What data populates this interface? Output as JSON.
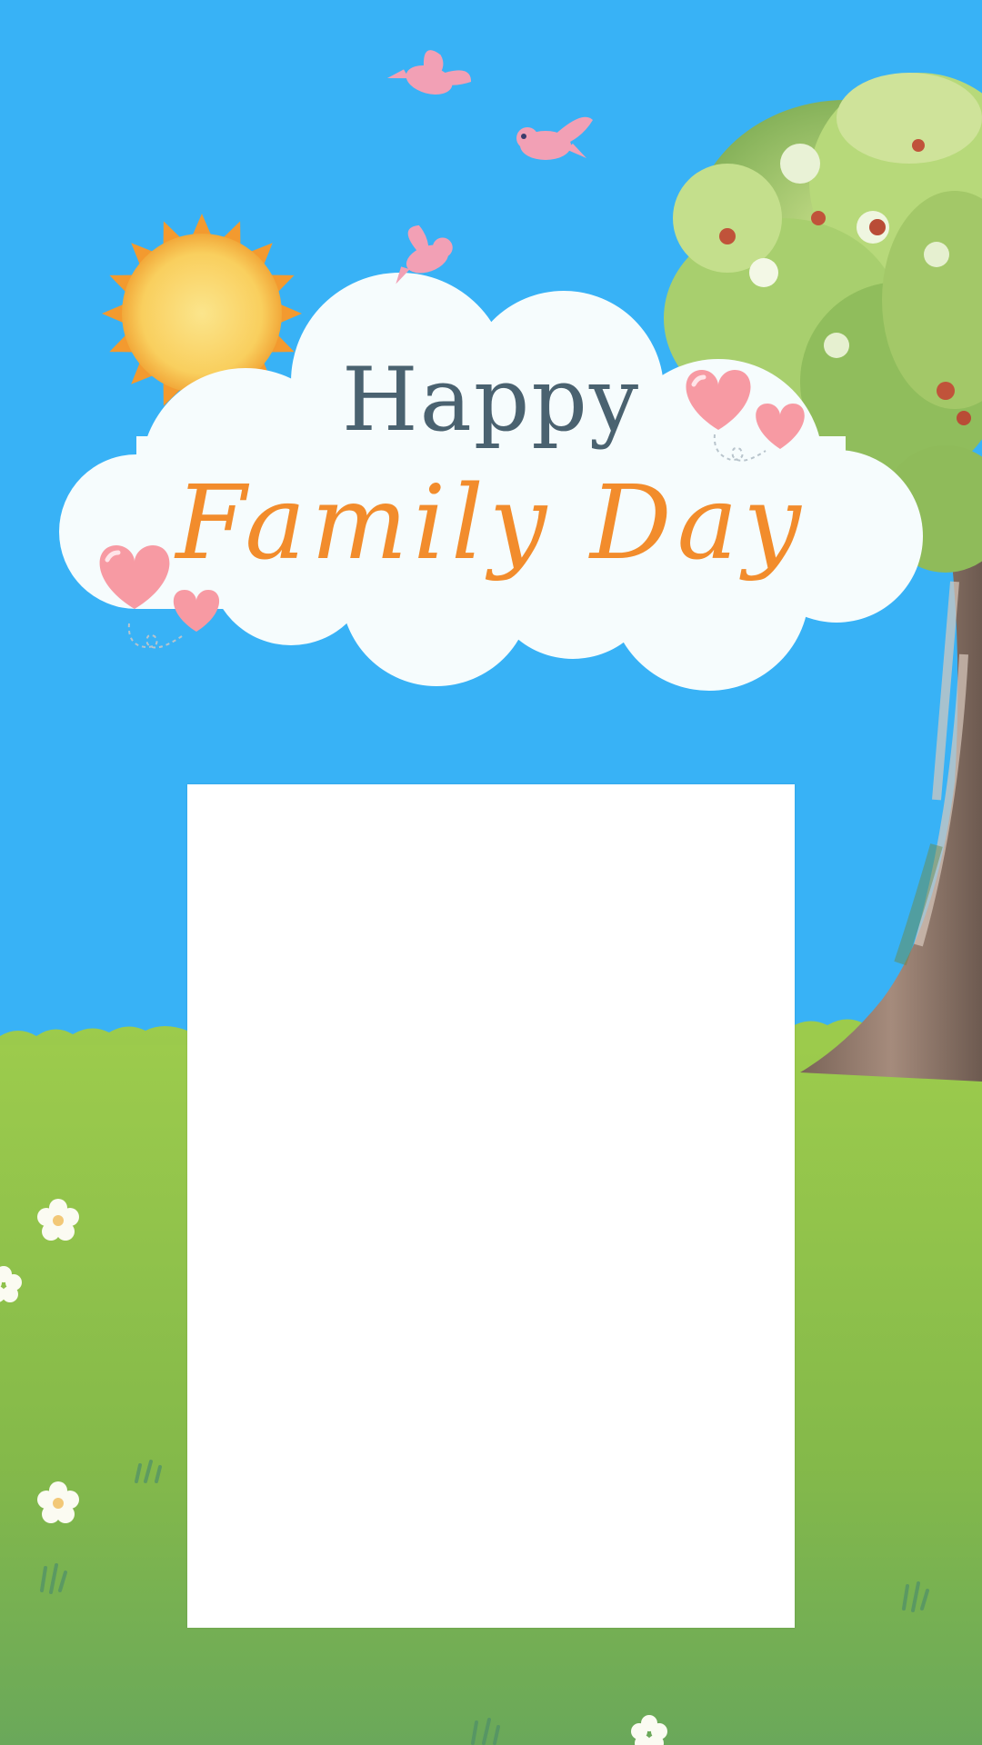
{
  "greeting": {
    "line1": "Happy",
    "line2": "Family Day"
  },
  "colors": {
    "sky": "#38b2f6",
    "grass": "#8cc048",
    "cloud": "#f6fcfd",
    "title": "#4a6270",
    "script": "#f28c2c",
    "heart": "#f79aa3",
    "photo_frame": "#ffffff"
  },
  "decorations": [
    "sun-icon",
    "bird-icon",
    "cloud",
    "heart-icon",
    "tree",
    "flower-icon"
  ]
}
